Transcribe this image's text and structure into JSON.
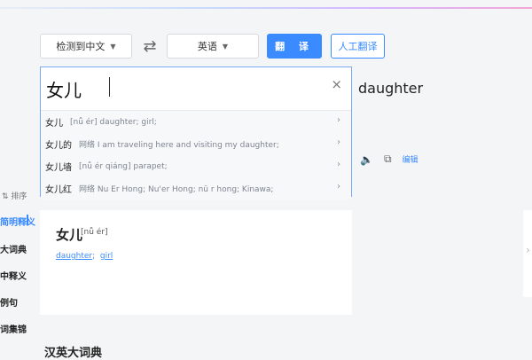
{
  "toolbar": {
    "source_lang": "检测到中文",
    "swap_icon": "⇄",
    "target_lang": "英语",
    "translate_label": "翻 译",
    "human_translate_label": "人工翻译"
  },
  "input": {
    "text": "女儿",
    "clear_icon": "×",
    "suggestions": [
      {
        "word": "女儿",
        "detail": "[nǚ ér] daughter; girl;"
      },
      {
        "word": "女儿的",
        "detail": "网络 I am traveling here and visiting my daughter;"
      },
      {
        "word": "女儿墙",
        "detail": "[nǚ ér qiáng] parapet;"
      },
      {
        "word": "女儿红",
        "detail": "网络 Nu Er Hong; Nu'er Hong; nü r hong; Kinawa;"
      }
    ]
  },
  "output": {
    "text": "daughter",
    "edit_label": "编辑"
  },
  "sidebar": {
    "sort_label": "排序",
    "items": [
      "简明释义",
      "大词典",
      "中释义",
      "例句",
      "词集锦"
    ]
  },
  "entry": {
    "word": "女儿",
    "pinyin": "[nǚ ér]",
    "meanings": [
      "daughter",
      "girl"
    ]
  },
  "section": {
    "title": "汉英大词典"
  },
  "colors": {
    "accent": "#3a8bff",
    "background": "#f4f5f7"
  }
}
